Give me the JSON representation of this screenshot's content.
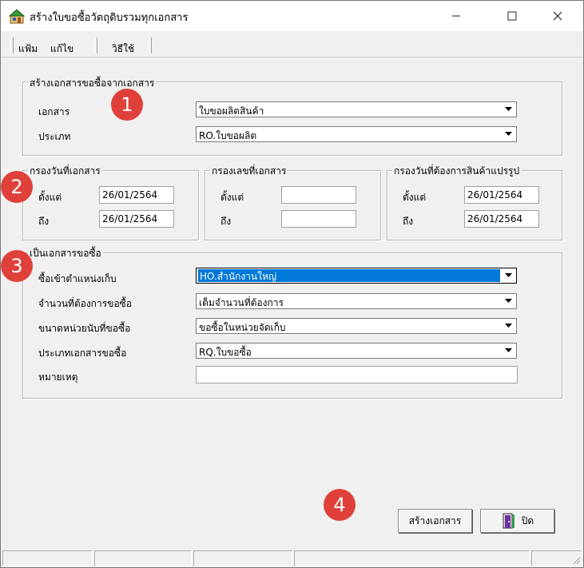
{
  "window": {
    "title": "สร้างใบขอซื้อวัตถุดิบรวมทุกเอกสาร",
    "minimize_glyph": "—",
    "maximize_glyph": "☐",
    "close_glyph": "✕"
  },
  "menu": {
    "file": "แฟ้ม",
    "edit": "แก้ไข",
    "help": "วิธีใช้"
  },
  "group1": {
    "legend": "สร้างเอกสารขอซื้อจากเอกสาร",
    "document_label": "เอกสาร",
    "document_value": "ใบขอผลิตสินค้า",
    "type_label": "ประเภท",
    "type_value": "RO.ใบขอผลิต"
  },
  "group_date": {
    "legend": "กรองวันที่เอกสาร",
    "from_label": "ตั้งแต่",
    "from_value": "26/01/2564",
    "to_label": "ถึง",
    "to_value": "26/01/2564"
  },
  "group_docno": {
    "legend": "กรองเลขที่เอกสาร",
    "from_label": "ตั้งแต่",
    "from_value": "",
    "to_label": "ถึง",
    "to_value": ""
  },
  "group_needdate": {
    "legend": "กรองวันที่ต้องการสินค้าแปรรูป",
    "from_label": "ตั้งแต่",
    "from_value": "26/01/2564",
    "to_label": "ถึง",
    "to_value": "26/01/2564"
  },
  "group3": {
    "legend": "เป็นเอกสารขอซื้อ",
    "warehouse_label": "ซื้อเข้าตำแหน่งเก็บ",
    "warehouse_value": "HO.สำนักงานใหญ่",
    "qty_label": "จำนวนที่ต้องการขอซื้อ",
    "qty_value": "เต็มจำนวนที่ต้องการ",
    "unit_label": "ขนาดหน่วยนับที่ขอซื้อ",
    "unit_value": "ขอซื้อในหน่วยจัดเก็บ",
    "doctype_label": "ประเภทเอกสารขอซื้อ",
    "doctype_value": "RQ.ใบขอซื้อ",
    "note_label": "หมายเหตุ",
    "note_value": ""
  },
  "buttons": {
    "create": "สร้างเอกสาร",
    "close": "ปิด"
  },
  "badges": [
    "1",
    "2",
    "3",
    "4"
  ],
  "colors": {
    "badge": "#e0403a",
    "selection": "#0078d7"
  }
}
